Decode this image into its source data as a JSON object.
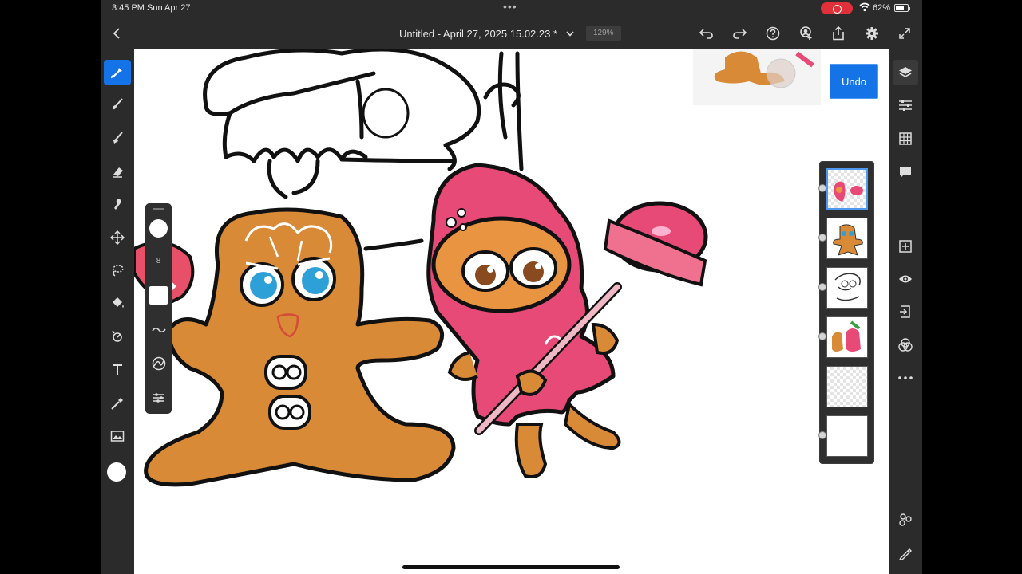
{
  "status_bar": {
    "time": "3:45 PM  Sun Apr 27",
    "dots": "•••",
    "battery": "62%"
  },
  "app_bar": {
    "title": "Untitled - April 27, 2025 15.02.23 *",
    "zoom": "129%"
  },
  "brush_panel": {
    "size_value": "8"
  },
  "undo": {
    "label": "Undo"
  },
  "icons": {
    "left_toolbar": [
      "selection-brush-icon",
      "brush-icon",
      "pixel-brush-icon",
      "eraser-icon",
      "smudge-icon",
      "move-icon",
      "lasso-icon",
      "fill-icon",
      "clone-icon",
      "text-icon",
      "eyedropper-icon",
      "image-icon"
    ],
    "right_toolbar": [
      "layers-icon",
      "adjustments-icon",
      "grid-icon",
      "comment-icon",
      "add-layer-icon",
      "visibility-icon",
      "import-icon",
      "blend-icon",
      "more-icon",
      "share-layers-icon",
      "pencil-icon"
    ]
  },
  "colors": {
    "accent": "#1473e6",
    "ui_dark": "#2b2b2b",
    "cookie": "#d98a36",
    "strawberry": "#e84a78"
  }
}
